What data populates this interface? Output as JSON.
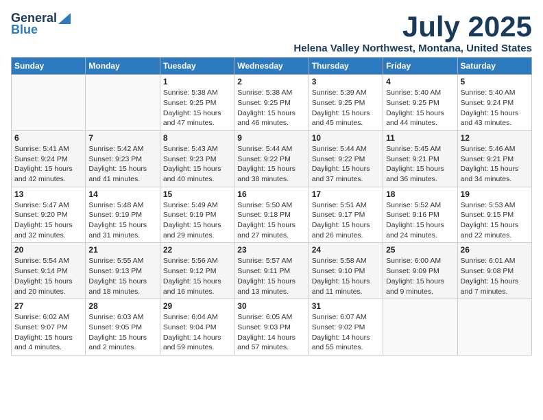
{
  "header": {
    "logo_general": "General",
    "logo_blue": "Blue",
    "title": "July 2025",
    "location": "Helena Valley Northwest, Montana, United States"
  },
  "weekdays": [
    "Sunday",
    "Monday",
    "Tuesday",
    "Wednesday",
    "Thursday",
    "Friday",
    "Saturday"
  ],
  "weeks": [
    [
      {
        "day": "",
        "detail": ""
      },
      {
        "day": "",
        "detail": ""
      },
      {
        "day": "1",
        "detail": "Sunrise: 5:38 AM\nSunset: 9:25 PM\nDaylight: 15 hours\nand 47 minutes."
      },
      {
        "day": "2",
        "detail": "Sunrise: 5:38 AM\nSunset: 9:25 PM\nDaylight: 15 hours\nand 46 minutes."
      },
      {
        "day": "3",
        "detail": "Sunrise: 5:39 AM\nSunset: 9:25 PM\nDaylight: 15 hours\nand 45 minutes."
      },
      {
        "day": "4",
        "detail": "Sunrise: 5:40 AM\nSunset: 9:25 PM\nDaylight: 15 hours\nand 44 minutes."
      },
      {
        "day": "5",
        "detail": "Sunrise: 5:40 AM\nSunset: 9:24 PM\nDaylight: 15 hours\nand 43 minutes."
      }
    ],
    [
      {
        "day": "6",
        "detail": "Sunrise: 5:41 AM\nSunset: 9:24 PM\nDaylight: 15 hours\nand 42 minutes."
      },
      {
        "day": "7",
        "detail": "Sunrise: 5:42 AM\nSunset: 9:23 PM\nDaylight: 15 hours\nand 41 minutes."
      },
      {
        "day": "8",
        "detail": "Sunrise: 5:43 AM\nSunset: 9:23 PM\nDaylight: 15 hours\nand 40 minutes."
      },
      {
        "day": "9",
        "detail": "Sunrise: 5:44 AM\nSunset: 9:22 PM\nDaylight: 15 hours\nand 38 minutes."
      },
      {
        "day": "10",
        "detail": "Sunrise: 5:44 AM\nSunset: 9:22 PM\nDaylight: 15 hours\nand 37 minutes."
      },
      {
        "day": "11",
        "detail": "Sunrise: 5:45 AM\nSunset: 9:21 PM\nDaylight: 15 hours\nand 36 minutes."
      },
      {
        "day": "12",
        "detail": "Sunrise: 5:46 AM\nSunset: 9:21 PM\nDaylight: 15 hours\nand 34 minutes."
      }
    ],
    [
      {
        "day": "13",
        "detail": "Sunrise: 5:47 AM\nSunset: 9:20 PM\nDaylight: 15 hours\nand 32 minutes."
      },
      {
        "day": "14",
        "detail": "Sunrise: 5:48 AM\nSunset: 9:19 PM\nDaylight: 15 hours\nand 31 minutes."
      },
      {
        "day": "15",
        "detail": "Sunrise: 5:49 AM\nSunset: 9:19 PM\nDaylight: 15 hours\nand 29 minutes."
      },
      {
        "day": "16",
        "detail": "Sunrise: 5:50 AM\nSunset: 9:18 PM\nDaylight: 15 hours\nand 27 minutes."
      },
      {
        "day": "17",
        "detail": "Sunrise: 5:51 AM\nSunset: 9:17 PM\nDaylight: 15 hours\nand 26 minutes."
      },
      {
        "day": "18",
        "detail": "Sunrise: 5:52 AM\nSunset: 9:16 PM\nDaylight: 15 hours\nand 24 minutes."
      },
      {
        "day": "19",
        "detail": "Sunrise: 5:53 AM\nSunset: 9:15 PM\nDaylight: 15 hours\nand 22 minutes."
      }
    ],
    [
      {
        "day": "20",
        "detail": "Sunrise: 5:54 AM\nSunset: 9:14 PM\nDaylight: 15 hours\nand 20 minutes."
      },
      {
        "day": "21",
        "detail": "Sunrise: 5:55 AM\nSunset: 9:13 PM\nDaylight: 15 hours\nand 18 minutes."
      },
      {
        "day": "22",
        "detail": "Sunrise: 5:56 AM\nSunset: 9:12 PM\nDaylight: 15 hours\nand 16 minutes."
      },
      {
        "day": "23",
        "detail": "Sunrise: 5:57 AM\nSunset: 9:11 PM\nDaylight: 15 hours\nand 13 minutes."
      },
      {
        "day": "24",
        "detail": "Sunrise: 5:58 AM\nSunset: 9:10 PM\nDaylight: 15 hours\nand 11 minutes."
      },
      {
        "day": "25",
        "detail": "Sunrise: 6:00 AM\nSunset: 9:09 PM\nDaylight: 15 hours\nand 9 minutes."
      },
      {
        "day": "26",
        "detail": "Sunrise: 6:01 AM\nSunset: 9:08 PM\nDaylight: 15 hours\nand 7 minutes."
      }
    ],
    [
      {
        "day": "27",
        "detail": "Sunrise: 6:02 AM\nSunset: 9:07 PM\nDaylight: 15 hours\nand 4 minutes."
      },
      {
        "day": "28",
        "detail": "Sunrise: 6:03 AM\nSunset: 9:05 PM\nDaylight: 15 hours\nand 2 minutes."
      },
      {
        "day": "29",
        "detail": "Sunrise: 6:04 AM\nSunset: 9:04 PM\nDaylight: 14 hours\nand 59 minutes."
      },
      {
        "day": "30",
        "detail": "Sunrise: 6:05 AM\nSunset: 9:03 PM\nDaylight: 14 hours\nand 57 minutes."
      },
      {
        "day": "31",
        "detail": "Sunrise: 6:07 AM\nSunset: 9:02 PM\nDaylight: 14 hours\nand 55 minutes."
      },
      {
        "day": "",
        "detail": ""
      },
      {
        "day": "",
        "detail": ""
      }
    ]
  ]
}
